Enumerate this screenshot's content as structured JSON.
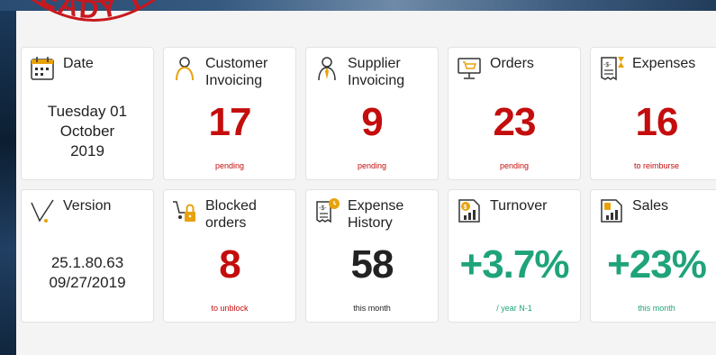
{
  "stamp": {
    "text": "READY TO"
  },
  "cards": {
    "date": {
      "title": "Date",
      "line1": "Tuesday 01",
      "line2": "October",
      "line3": "2019"
    },
    "customer": {
      "title1": "Customer",
      "title2": "Invoicing",
      "value": "17",
      "sub": "pending"
    },
    "supplier": {
      "title1": "Supplier",
      "title2": "Invoicing",
      "value": "9",
      "sub": "pending"
    },
    "orders": {
      "title": "Orders",
      "value": "23",
      "sub": "pending"
    },
    "expenses": {
      "title": "Expenses",
      "value": "16",
      "sub": "to reimburse"
    },
    "version": {
      "title": "Version",
      "line1": "25.1.80.63",
      "line2": "09/27/2019"
    },
    "blocked": {
      "title1": "Blocked",
      "title2": "orders",
      "value": "8",
      "sub": "to unblock"
    },
    "history": {
      "title1": "Expense",
      "title2": "History",
      "value": "58",
      "sub": "this month"
    },
    "turnover": {
      "title": "Turnover",
      "value": "+3.7%",
      "sub": "/ year N-1"
    },
    "sales": {
      "title": "Sales",
      "value": "+23%",
      "sub": "this month"
    }
  },
  "icons": {
    "date": "calendar-icon",
    "customer": "person-icon",
    "supplier": "person-tie-icon",
    "orders": "monitor-cart-icon",
    "expenses": "receipt-hourglass-icon",
    "version": "version-check-icon",
    "blocked": "cart-lock-icon",
    "history": "receipt-clock-icon",
    "turnover": "chart-coin-icon",
    "sales": "document-chart-icon"
  },
  "colors": {
    "alert": "#c40d0d",
    "positive": "#1fa37a",
    "icon_accent": "#e8a20c"
  }
}
